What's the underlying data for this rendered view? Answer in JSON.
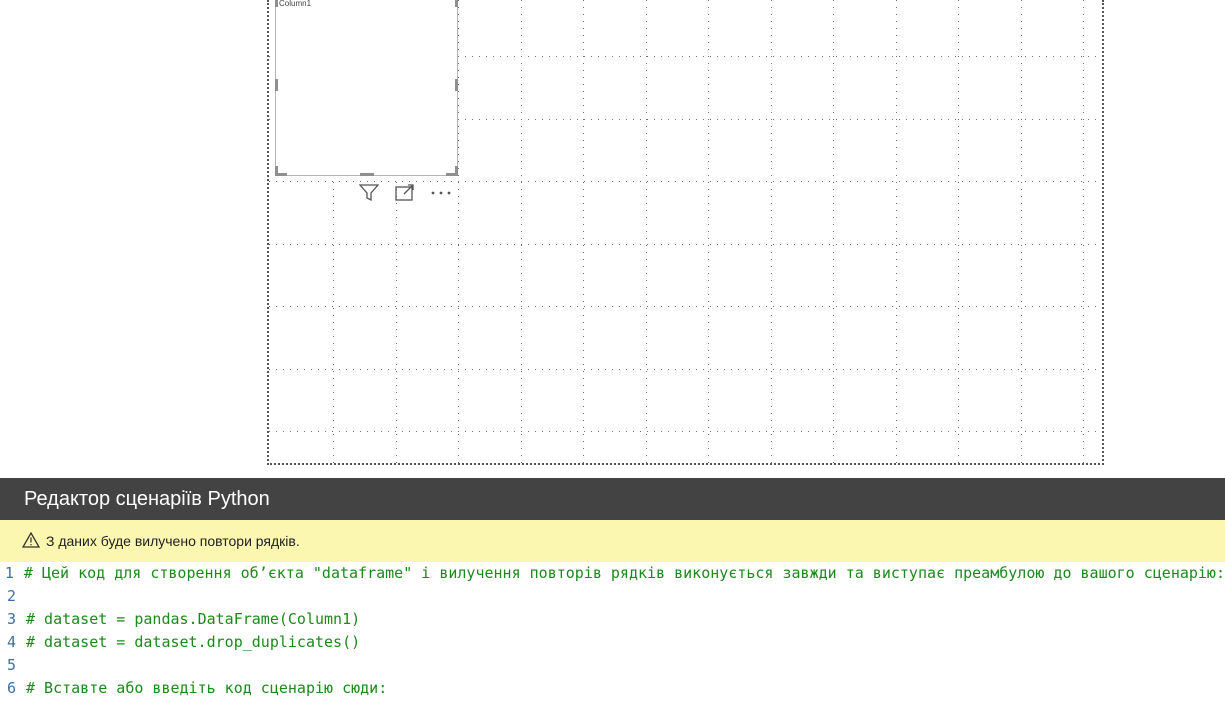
{
  "visual": {
    "column_label": "Column1"
  },
  "toolbar": {
    "icons": [
      "filter-icon",
      "focus-mode-icon",
      "more-options-icon"
    ]
  },
  "editor": {
    "title": "Редактор сценаріїв Python",
    "warning": "З даних буде вилучено повтори рядків.",
    "lines": [
      {
        "num": "1",
        "text": "# Цей код для створення об’єкта \"dataframe\" і вилучення повторів рядків виконується завжди та виступає преамбулою до вашого сценарію:"
      },
      {
        "num": "2",
        "text": ""
      },
      {
        "num": "3",
        "text": "# dataset = pandas.DataFrame(Column1)"
      },
      {
        "num": "4",
        "text": "# dataset = dataset.drop_duplicates()"
      },
      {
        "num": "5",
        "text": ""
      },
      {
        "num": "6",
        "text": "# Вставте або введіть код сценарію сюди:"
      }
    ]
  },
  "colors": {
    "header_bg": "#434343",
    "warning_bg": "#fbf7b0",
    "code_comment": "#1b8a1b",
    "line_number": "#3f6fa0"
  }
}
